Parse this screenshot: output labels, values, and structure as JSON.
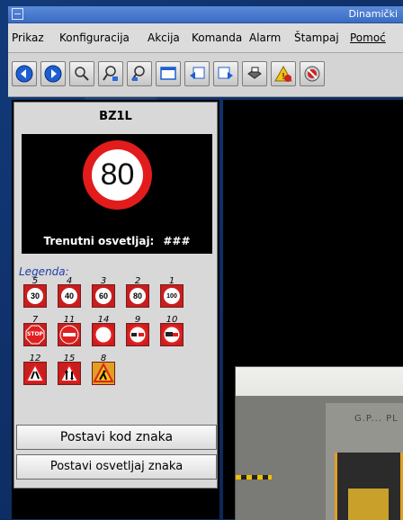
{
  "window": {
    "title": "Dinamički"
  },
  "menu": [
    {
      "label": "Prikaz"
    },
    {
      "label": "Konfiguracija"
    },
    {
      "label": "Akcija"
    },
    {
      "label": "Komanda"
    },
    {
      "label": "Alarm"
    },
    {
      "label": "Štampaj"
    },
    {
      "label": "Pomoć"
    }
  ],
  "toolbar": {
    "buttons": [
      "back-icon",
      "forward-icon",
      "zoom-icon",
      "zoom-in-icon",
      "zoom-out-icon",
      "window-icon",
      "arrow-left-icon",
      "arrow-right-icon",
      "printer-icon",
      "warning-icon",
      "alarm-off-icon"
    ]
  },
  "panel": {
    "title": "BZ1L",
    "current_sign": "80",
    "illumination_label": "Trenutni osvetljaj:",
    "illumination_value": "###",
    "legend_label": "Legenda:",
    "legend": [
      {
        "code": "5",
        "sign": "30",
        "type": "speed"
      },
      {
        "code": "4",
        "sign": "40",
        "type": "speed"
      },
      {
        "code": "3",
        "sign": "60",
        "type": "speed"
      },
      {
        "code": "2",
        "sign": "80",
        "type": "speed"
      },
      {
        "code": "1",
        "sign": "100",
        "type": "speed"
      },
      {
        "code": "7",
        "sign": "STOP",
        "type": "stop"
      },
      {
        "code": "11",
        "sign": "",
        "type": "no-entry"
      },
      {
        "code": "14",
        "sign": "",
        "type": "no-vehicles"
      },
      {
        "code": "9",
        "sign": "",
        "type": "no-overtaking"
      },
      {
        "code": "10",
        "sign": "",
        "type": "no-overtaking-truck"
      },
      {
        "code": "12",
        "sign": "",
        "type": "warning-narrowing"
      },
      {
        "code": "15",
        "sign": "",
        "type": "warning-two-way"
      },
      {
        "code": "8",
        "sign": "",
        "type": "roadworks"
      }
    ],
    "set_code_button": "Postavi kod znaka",
    "set_illum_button": "Postavi osvetljaj znaka"
  },
  "camera": {
    "sign_text": "G.P... PL"
  },
  "colors": {
    "sign_red": "#c81e1e",
    "legend_blue": "#1e3fa8"
  }
}
